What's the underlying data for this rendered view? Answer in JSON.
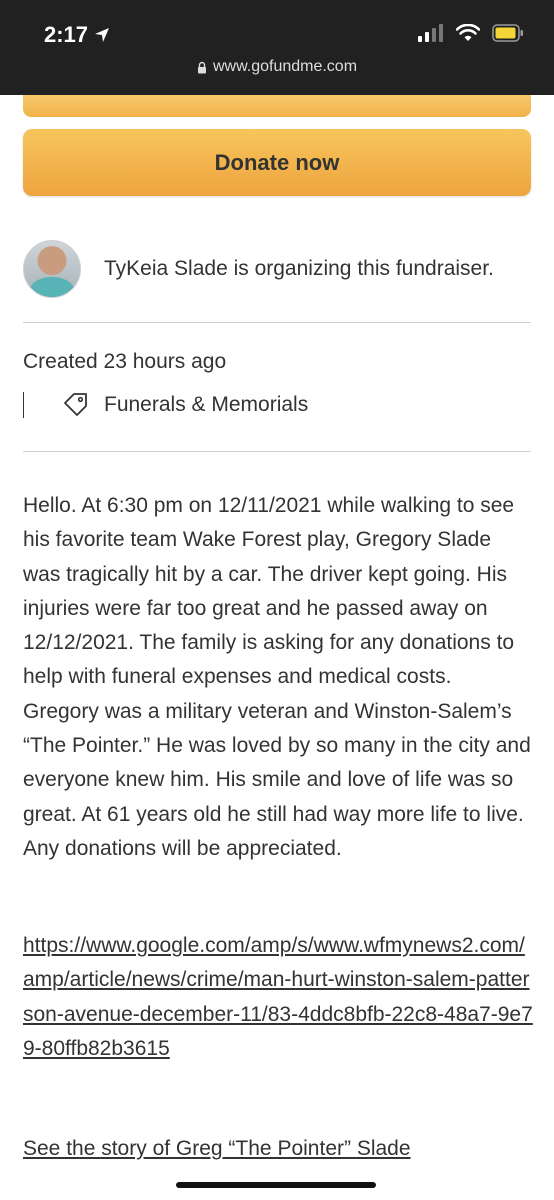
{
  "status_bar": {
    "time": "2:17",
    "url": "www.gofundme.com"
  },
  "donate_button": {
    "label": "Donate now"
  },
  "organizer": {
    "text": "TyKeia Slade is organizing this fundraiser."
  },
  "meta": {
    "created": "Created 23 hours ago",
    "category": "Funerals & Memorials"
  },
  "story": {
    "text": "Hello. At 6:30 pm on 12/11/2021 while walking to see his favorite team Wake Forest play, Gregory Slade was tragically hit by a car. The driver kept going. His injuries were far too great and he passed away on 12/12/2021. The family is asking for any donations to help with funeral expenses and medical costs. Gregory was a military veteran and Winston-Salem’s “The Pointer.” He was loved by so many in the city and everyone knew him. His smile and love of life was so great. At 61 years old he still had way more life to live. Any donations will be appreciated.",
    "link": "https://www.google.com/amp/s/www.wfmynews2.com/amp/article/news/crime/man-hurt-winston-salem-patterson-avenue-december-11/83-4ddc8bfb-22c8-48a7-9e79-80ffb82b3615",
    "see_story_link": "See the story of Greg “The Pointer” Slade"
  },
  "colors": {
    "status_bar_bg": "#212121",
    "donate_gradient_top": "#f7c55c",
    "donate_gradient_bottom": "#eea43f",
    "battery": "#f5d437"
  }
}
